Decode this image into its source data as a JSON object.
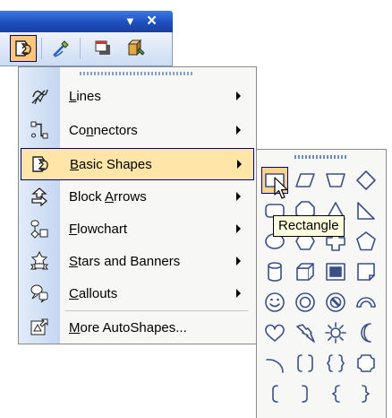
{
  "toolbar": {
    "icons": [
      "autoshapes-icon",
      "line-color-icon",
      "shadow-style-icon",
      "3d-style-icon"
    ],
    "title_buttons": {
      "dropdown": "▼",
      "close": "×"
    }
  },
  "menu": {
    "items": [
      {
        "label": "Lines",
        "mnemonic": "L",
        "icon": "lines-icon",
        "has_submenu": true
      },
      {
        "label": "Connectors",
        "mnemonic": "n",
        "icon": "connectors-icon",
        "has_submenu": true
      },
      {
        "label": "Basic Shapes",
        "mnemonic": "B",
        "icon": "basic-shapes-icon",
        "has_submenu": true,
        "highlighted": true
      },
      {
        "label": "Block Arrows",
        "mnemonic": "A",
        "icon": "block-arrows-icon",
        "has_submenu": true
      },
      {
        "label": "Flowchart",
        "mnemonic": "F",
        "icon": "flowchart-icon",
        "has_submenu": true
      },
      {
        "label": "Stars and Banners",
        "mnemonic": "S",
        "icon": "stars-banners-icon",
        "has_submenu": true
      },
      {
        "label": "Callouts",
        "mnemonic": "C",
        "icon": "callouts-icon",
        "has_submenu": true
      },
      {
        "label": "More AutoShapes...",
        "mnemonic": "M",
        "icon": "more-autoshapes-icon",
        "has_submenu": false
      }
    ]
  },
  "palette": {
    "shapes": [
      "rectangle",
      "parallelogram",
      "trapezoid",
      "diamond",
      "rounded-rectangle",
      "octagon",
      "isosceles-triangle",
      "right-triangle",
      "oval",
      "hexagon",
      "cross",
      "pentagon",
      "can",
      "cube",
      "bevel",
      "folded-corner",
      "smiley-face",
      "donut",
      "no-symbol",
      "block-arc",
      "heart",
      "lightning-bolt",
      "sun",
      "moon",
      "arc",
      "double-bracket",
      "double-brace",
      "plaque",
      "left-bracket",
      "right-bracket",
      "left-brace",
      "right-brace"
    ],
    "selected": "rectangle",
    "outline_color": "#3a4f8a",
    "highlight_color": "#ffd48a"
  },
  "tooltip": {
    "text": "Rectangle"
  }
}
